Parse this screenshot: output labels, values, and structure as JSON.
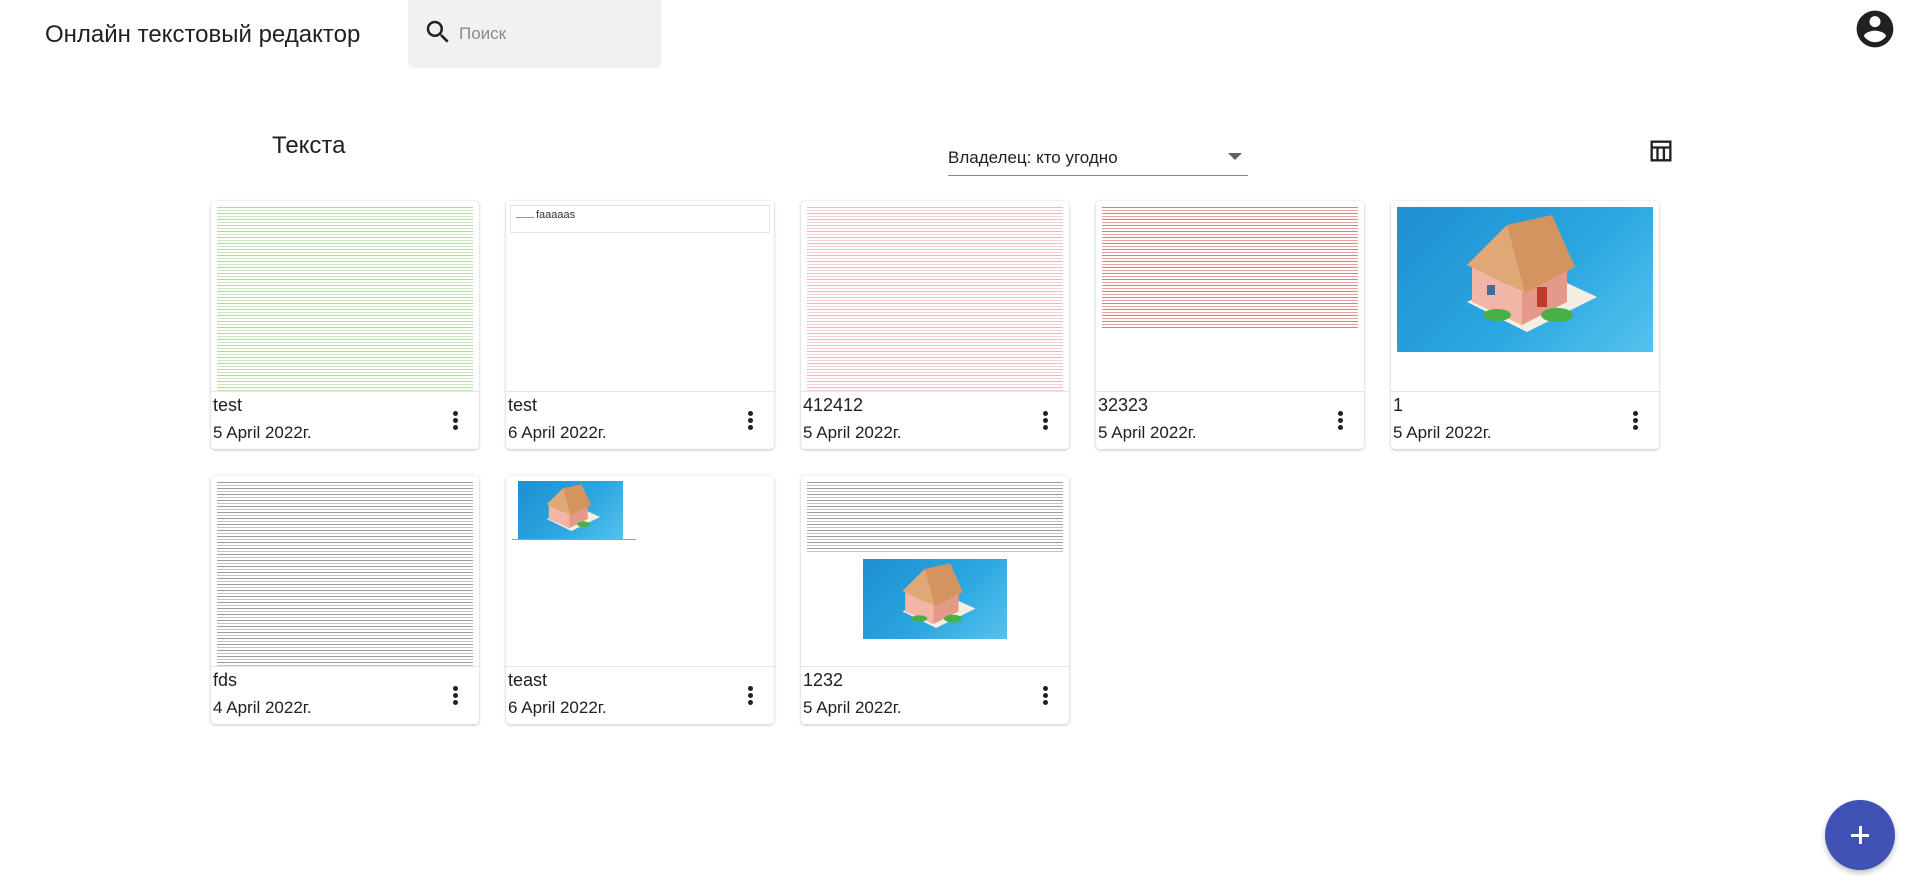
{
  "header": {
    "app_title": "Онлайн текстовый редактор",
    "search_placeholder": "Поиск",
    "search_value": ""
  },
  "toolbar": {
    "section_title": "Текста",
    "owner_filter": "Владелец: кто угодно"
  },
  "documents": [
    {
      "title": "test",
      "date": "5 April 2022г.",
      "thumbnail": "green-text"
    },
    {
      "title": "test",
      "date": "6 April 2022г.",
      "thumbnail": "faaaaas",
      "preview_text": "faaaaas"
    },
    {
      "title": "412412",
      "date": "5 April 2022г.",
      "thumbnail": "pink-text"
    },
    {
      "title": "32323",
      "date": "5 April 2022г.",
      "thumbnail": "red-text"
    },
    {
      "title": "1",
      "date": "5 April 2022г.",
      "thumbnail": "house-image"
    },
    {
      "title": "fds",
      "date": "4 April 2022г.",
      "thumbnail": "gray-text"
    },
    {
      "title": "teast",
      "date": "6 April 2022г.",
      "thumbnail": "small-house-image"
    },
    {
      "title": "1232",
      "date": "5 April 2022г.",
      "thumbnail": "text-and-house-image"
    }
  ],
  "colors": {
    "accent": "#3f51b5",
    "search_bg": "#f1f1f1"
  },
  "icons": [
    "search-icon",
    "account-circle-icon",
    "dropdown-arrow-icon",
    "table-view-icon",
    "more-vert-icon",
    "add-icon"
  ]
}
